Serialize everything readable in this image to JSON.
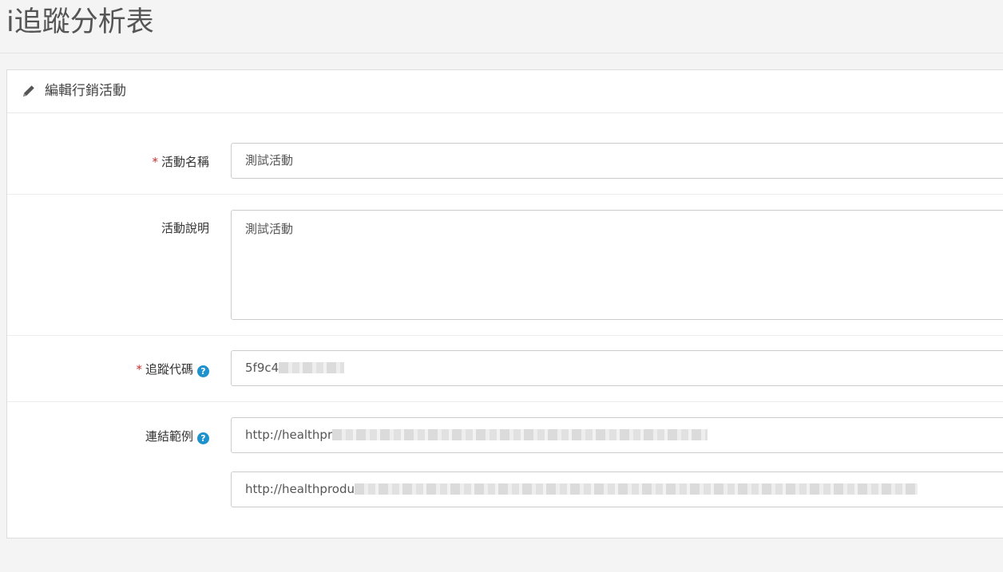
{
  "page": {
    "title": "i追蹤分析表"
  },
  "panel": {
    "icon": "pencil-icon",
    "title": "編輯行銷活動"
  },
  "form": {
    "name": {
      "required_mark": "*",
      "label": "活動名稱",
      "value": "測試活動"
    },
    "description": {
      "label": "活動說明",
      "value": "測試活動"
    },
    "tracking_code": {
      "required_mark": "*",
      "label": "追蹤代碼",
      "help": "?",
      "value": "5f9c4"
    },
    "link_examples": {
      "label": "連結範例",
      "help": "?",
      "values": [
        "http://healthpr",
        "http://healthprodu"
      ]
    }
  },
  "colors": {
    "required": "#c9302c",
    "help": "#1e91cf"
  }
}
